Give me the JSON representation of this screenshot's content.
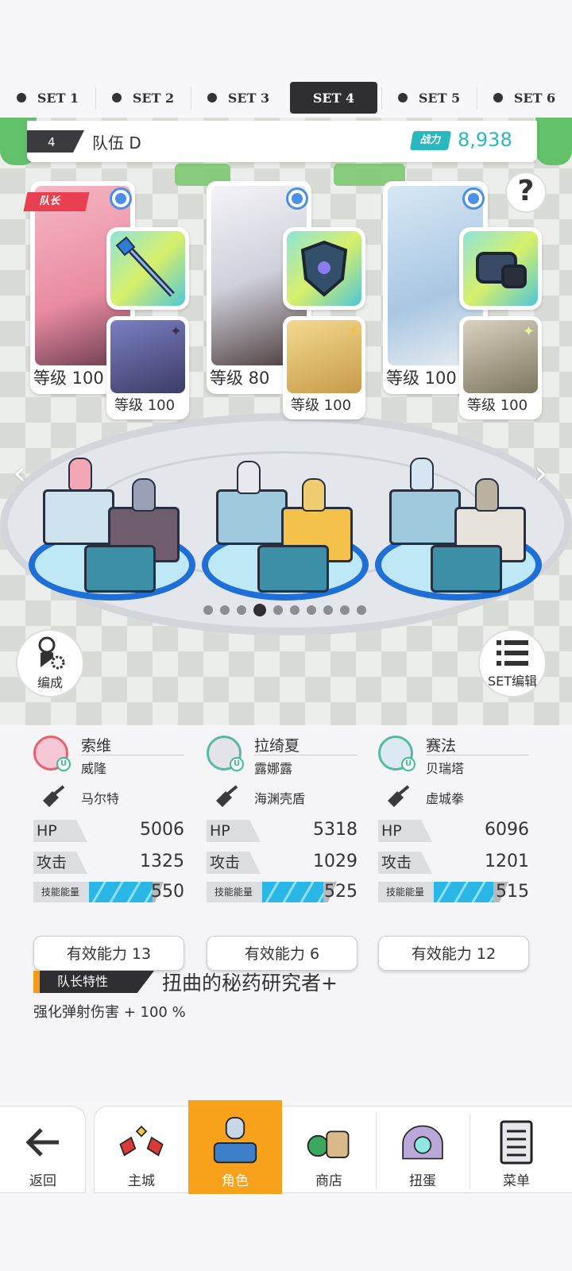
{
  "tabs": [
    {
      "label": "SET 1",
      "active": false
    },
    {
      "label": "SET 2",
      "active": false
    },
    {
      "label": "SET 3",
      "active": false
    },
    {
      "label": "SET 4",
      "active": true
    },
    {
      "label": "SET 5",
      "active": false
    },
    {
      "label": "SET 6",
      "active": false
    }
  ],
  "team": {
    "number": "4",
    "name": "队伍 D",
    "power_label": "战力",
    "power_value": "8,938"
  },
  "help_icon": "?",
  "members": [
    {
      "leader_tag": "队长",
      "level": "等级 100",
      "sub_level": "等级 100",
      "sub_spark": "✦",
      "portrait": "#f2a9b8",
      "sub_portrait": "#5d5f8f",
      "equip": "staff-icon"
    },
    {
      "leader_tag": "",
      "level": "等级 80",
      "sub_level": "等级 100",
      "sub_spark": "⚡",
      "portrait": "#d8d8e0",
      "sub_portrait": "#e8c776",
      "equip": "shield-icon"
    },
    {
      "leader_tag": "",
      "level": "等级 100",
      "sub_level": "等级 100",
      "sub_spark": "✦",
      "portrait": "#c8dff0",
      "sub_portrait": "#b9b2a0",
      "equip": "gauntlet-icon"
    }
  ],
  "nav_arrows": {
    "left": "‹",
    "right": "›"
  },
  "page_dots": {
    "count": 10,
    "active": 3
  },
  "edit_button": {
    "label": "编成"
  },
  "set_edit_button": {
    "label": "SET编辑"
  },
  "heroes": [
    {
      "name": "索维",
      "sub_name": "威隆",
      "weapon": "马尔特",
      "hp_label": "HP",
      "hp": "5006",
      "atk_label": "攻击",
      "atk": "1325",
      "energy_label": "技能能量",
      "energy": "550",
      "energy_fill": 0.85,
      "ability": "有效能力 13",
      "avatar_color": "#f6c7d4",
      "ring_color": "#e8626e",
      "badge": "U"
    },
    {
      "name": "拉绮夏",
      "sub_name": "露娜露",
      "weapon": "海渊壳盾",
      "hp_label": "HP",
      "hp": "5318",
      "atk_label": "攻击",
      "atk": "1029",
      "energy_label": "技能能量",
      "energy": "525",
      "energy_fill": 0.82,
      "ability": "有效能力 6",
      "avatar_color": "#e4e4ea",
      "ring_color": "#58b9a2",
      "badge": "U"
    },
    {
      "name": "赛法",
      "sub_name": "贝瑞塔",
      "weapon": "虚城拳",
      "hp_label": "HP",
      "hp": "6096",
      "atk_label": "攻击",
      "atk": "1201",
      "energy_label": "技能能量",
      "energy": "515",
      "energy_fill": 0.8,
      "ability": "有效能力 12",
      "avatar_color": "#dbe9f3",
      "ring_color": "#58b9a2",
      "badge": "U"
    }
  ],
  "leader_trait": {
    "tag": "队长特性",
    "name": "扭曲的秘药研究者+",
    "desc": "强化弹射伤害 + 100 %"
  },
  "bottom_nav": {
    "back": {
      "label": "返回",
      "icon": "arrow-left-icon"
    },
    "items": [
      {
        "label": "主城",
        "icon": "castle-icon",
        "active": false
      },
      {
        "label": "角色",
        "icon": "character-icon",
        "active": true
      },
      {
        "label": "商店",
        "icon": "shop-icon",
        "active": false
      },
      {
        "label": "扭蛋",
        "icon": "gacha-icon",
        "active": false
      },
      {
        "label": "菜单",
        "icon": "menu-icon",
        "active": false
      }
    ]
  }
}
